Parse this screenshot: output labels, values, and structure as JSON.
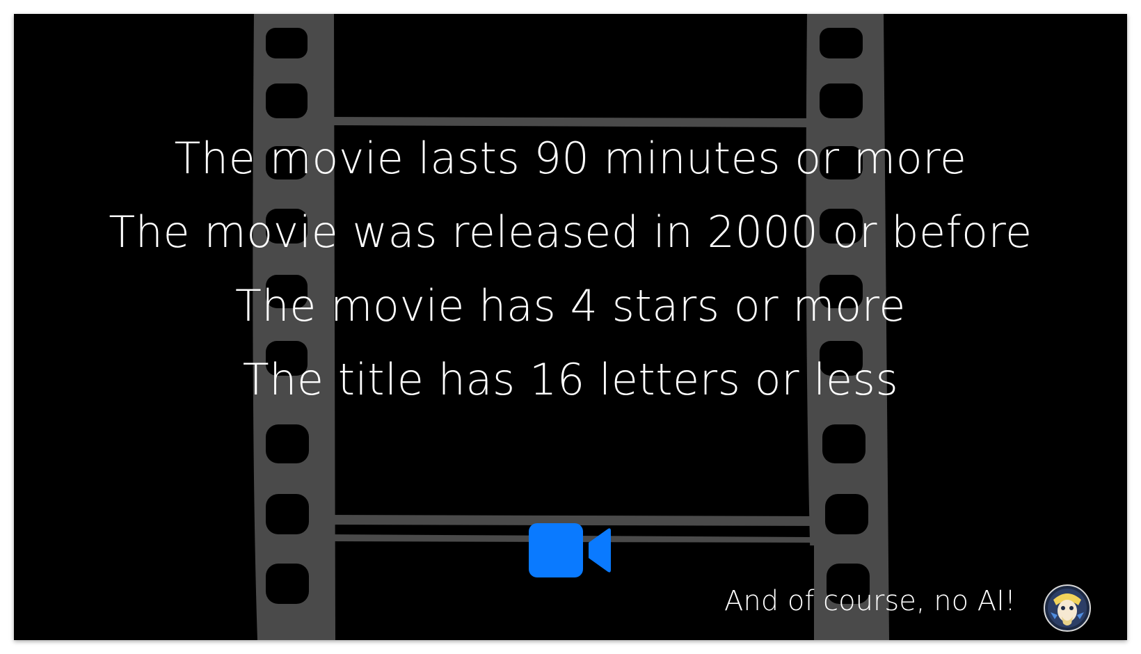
{
  "rules": [
    "The movie lasts 90 minutes or more",
    "The movie was released in 2000 or before",
    "The movie has 4 stars or more",
    "The title has 16 letters or less"
  ],
  "footer": {
    "text": "And of course, no AI!"
  },
  "icons": {
    "camera": "video-camera-icon",
    "avatar": "avatar"
  },
  "colors": {
    "background": "#000000",
    "film": "#4a4a4a",
    "text": "#ffffff",
    "accent": "#0a7aff"
  }
}
